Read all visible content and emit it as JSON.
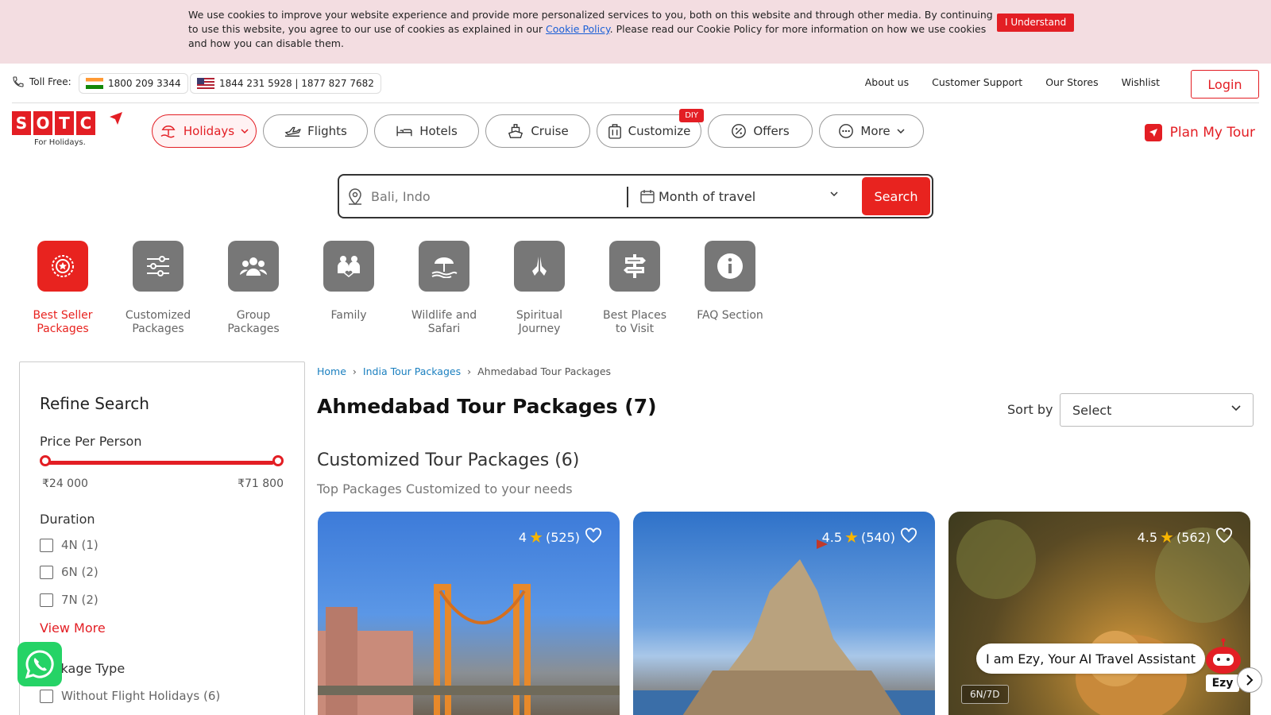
{
  "cookie": {
    "text_before": "We use cookies to improve your website experience and provide more personalized services to you, both on this website and through other media. By continuing to use this website, you agree to our use of cookies as explained in our ",
    "link": "Cookie Policy",
    "text_after": ". Please read our Cookie Policy for more information on how we use cookies and how you can disable them.",
    "button": "I Understand"
  },
  "topbar": {
    "toll_free_label": "Toll Free:",
    "india_number": "1800 209 3344",
    "us_numbers": "1844 231 5928 | 1877 827 7682",
    "links": [
      "About us",
      "Customer Support",
      "Our Stores",
      "Wishlist"
    ],
    "login": "Login"
  },
  "logo": {
    "letters": [
      "S",
      "O",
      "T",
      "C"
    ],
    "tagline": "For Holidays."
  },
  "nav": {
    "tabs": [
      {
        "label": "Holidays",
        "icon": "beach-umbrella-icon",
        "active": true,
        "dropdown": true
      },
      {
        "label": "Flights",
        "icon": "airplane-icon"
      },
      {
        "label": "Hotels",
        "icon": "bed-icon"
      },
      {
        "label": "Cruise",
        "icon": "ship-icon"
      },
      {
        "label": "Customize",
        "icon": "luggage-icon",
        "badge": "DIY"
      },
      {
        "label": "Offers",
        "icon": "discount-icon"
      },
      {
        "label": "More",
        "icon": "dots-icon",
        "dropdown": true
      }
    ],
    "plan_my_tour": "Plan My Tour"
  },
  "search": {
    "destination_placeholder": "Bali, Indo",
    "month": "Month of travel",
    "button": "Search"
  },
  "themes": [
    {
      "label": "Best Seller Packages",
      "icon": "badge-star-icon",
      "active": true
    },
    {
      "label": "Customized Packages",
      "icon": "sliders-icon"
    },
    {
      "label": "Group Packages",
      "icon": "group-icon"
    },
    {
      "label": "Family",
      "icon": "family-icon"
    },
    {
      "label": "Wildlife and Safari",
      "icon": "safari-icon"
    },
    {
      "label": "Spiritual Journey",
      "icon": "praying-hands-icon"
    },
    {
      "label": "Best Places to Visit",
      "icon": "signpost-icon"
    },
    {
      "label": "FAQ Section",
      "icon": "info-icon"
    }
  ],
  "refine": {
    "title": "Refine Search",
    "price_label": "Price Per Person",
    "price_min": "₹24 000",
    "price_max": "₹71 800",
    "duration_label": "Duration",
    "durations": [
      "4N (1)",
      "6N (2)",
      "7N (2)"
    ],
    "view_more": "View More",
    "package_type_label": "Package Type",
    "package_types": [
      "Without Flight Holidays (6)"
    ]
  },
  "breadcrumb": [
    "Home",
    "India Tour Packages",
    "Ahmedabad Tour Packages"
  ],
  "page_title": "Ahmedabad Tour Packages (7)",
  "sort": {
    "label": "Sort by",
    "value": "Select"
  },
  "section": {
    "title": "Customized Tour Packages (6)",
    "subtitle": "Top Packages Customized to your needs"
  },
  "cards": [
    {
      "rating": "4",
      "reviews": "(525)"
    },
    {
      "rating": "4.5",
      "reviews": "(540)"
    },
    {
      "rating": "4.5",
      "reviews": "(562)",
      "duration": "6N/7D"
    }
  ],
  "assistant": {
    "bubble": "I am Ezy, Your AI Travel Assistant",
    "name": "Ezy"
  },
  "colors": {
    "brand_red": "#e31e24",
    "cookie_bg": "#f3dde1",
    "whatsapp": "#25d366"
  }
}
